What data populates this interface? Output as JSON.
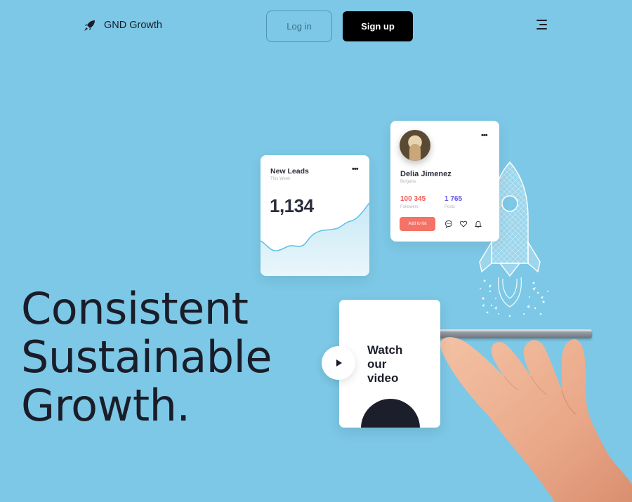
{
  "nav": {
    "brand_name": "GND Growth",
    "brand_icon": "rocket-icon",
    "login_label": "Log in",
    "signup_label": "Sign up",
    "menu_icon": "hamburger-menu-icon"
  },
  "hero": {
    "headline_lines": [
      "Consistent",
      "Sustainable",
      "Growth."
    ]
  },
  "leads_card": {
    "title": "New Leads",
    "subtitle": "This Week",
    "value": "1,134",
    "menu_icon": "more-dots-icon"
  },
  "profile_card": {
    "name": "Delia Jimenez",
    "location": "Bulgaria",
    "followers_value": "100 345",
    "followers_label": "Followers",
    "posts_value": "1 765",
    "posts_label": "Posts",
    "add_button_label": "Add to list",
    "menu_icon": "more-dots-icon",
    "action_icons": [
      "chat-icon",
      "heart-icon",
      "bell-icon"
    ]
  },
  "video_card": {
    "title_lines": [
      "Watch",
      "our",
      "video"
    ],
    "play_icon": "play-icon"
  },
  "colors": {
    "background": "#7cc8e6",
    "text_dark": "#1a1d29",
    "followers_red": "#ee5b55",
    "posts_purple": "#6358e8",
    "add_button": "#f47266",
    "chart_line": "#5fc3e8"
  }
}
